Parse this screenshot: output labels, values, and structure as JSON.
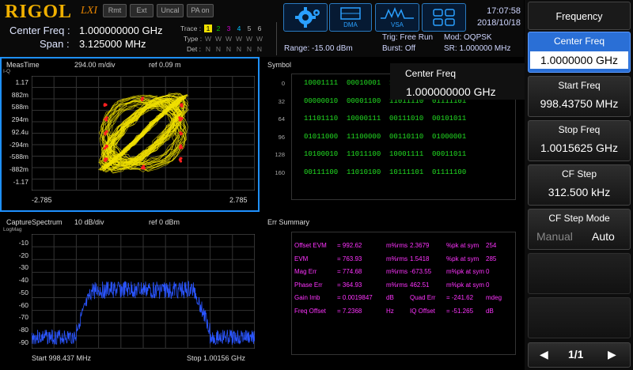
{
  "header": {
    "logo": "RIGOL",
    "lxi": "LXI",
    "status_buttons": [
      "Rmt",
      "Ext",
      "Uncal",
      "PA on"
    ],
    "center_freq_label": "Center Freq :",
    "center_freq_value": "1.000000000 GHz",
    "span_label": "Span :",
    "span_value": "3.125000 MHz",
    "trace_label": "Trace :",
    "trace_numbers": [
      "1",
      "2",
      "3",
      "4",
      "5",
      "6"
    ],
    "type_label": "Type :",
    "type_values": [
      "W",
      "W",
      "W",
      "W",
      "W",
      "W"
    ],
    "det_label": "Det :",
    "det_values": [
      "N",
      "N",
      "N",
      "N",
      "N",
      "N"
    ],
    "range": "Range: -15.00 dBm",
    "trig": "Trig: Free Run",
    "burst": "Burst: Off",
    "mod": "Mod: OQPSK",
    "sr": "SR: 1.000000 MHz",
    "dma": "DMA",
    "vsa": "VSA",
    "time": "17:07:58",
    "date": "2018/10/18",
    "colors": {
      "trace1": "#f0e000",
      "trace2": "#00d000",
      "trace3": "#d000d0",
      "trace4": "#00c0ff",
      "trace5": "#bbbbbb",
      "trace6": "#bbbbbb"
    }
  },
  "meas": {
    "title": "MeasTime",
    "scale": "294.00 m/div",
    "ref": "ref 0.09 m",
    "iq": "I-Q",
    "ylabels": [
      "1.17",
      "882m",
      "588m",
      "294m",
      "92.4u",
      "-294m",
      "-588m",
      "-882m",
      "-1.17"
    ],
    "xleft": "-2.785",
    "xright": "2.785"
  },
  "symbol": {
    "title": "Symbol",
    "rows": [
      {
        "idx": "0",
        "bits": "10001111  00010001  11011110  10111010"
      },
      {
        "idx": "32",
        "bits": "00000010  00001100  11011110  01111101"
      },
      {
        "idx": "64",
        "bits": "11101110  10000111  00111010  00101011"
      },
      {
        "idx": "96",
        "bits": "01011000  11100000  00110110  01000001"
      },
      {
        "idx": "128",
        "bits": "10100010  11011100  10001111  00011011"
      },
      {
        "idx": "160",
        "bits": "00111100  11010100  10111101  01111100"
      }
    ],
    "popup_label": "Center Freq",
    "popup_value": "1.000000000 GHz"
  },
  "spectrum": {
    "title": "CaptureSpectrum",
    "scale": "10 dB/div",
    "ref": "ref 0 dBm",
    "logmag": "LogMag",
    "ylabels": [
      "-10",
      "-20",
      "-30",
      "-40",
      "-50",
      "-60",
      "-70",
      "-80",
      "-90"
    ],
    "start": "Start 998.437 MHz",
    "stop": "Stop 1.00156 GHz"
  },
  "err": {
    "title": "Err Summary",
    "rows": [
      [
        "Offset EVM",
        "= 992.62",
        "m%rms",
        "2.3679",
        "%pk at sym",
        "254"
      ],
      [
        "EVM",
        "= 763.93",
        "m%rms",
        "1.5418",
        "%pk at sym",
        "285"
      ],
      [
        "Mag Err",
        "= 774.68",
        "m%rms",
        "-673.55",
        "m%pk at sym",
        "0"
      ],
      [
        "Phase Err",
        "= 364.93",
        "m%rms",
        "462.51",
        "m%pk at sym",
        "0"
      ],
      [
        "Gain Imb",
        "= 0.0019847",
        "dB",
        "Quad Err",
        "= -241.62",
        "mdeg"
      ],
      [
        "Freq Offset",
        "= 7.2368",
        "Hz",
        "IQ Offset",
        "= -51.265",
        "dB"
      ]
    ]
  },
  "menu": {
    "title": "Frequency",
    "items": [
      {
        "label": "Center Freq",
        "value": "1.0000000 GHz"
      },
      {
        "label": "Start Freq",
        "value": "998.43750 MHz"
      },
      {
        "label": "Stop Freq",
        "value": "1.0015625 GHz"
      },
      {
        "label": "CF Step",
        "value": "312.500 kHz"
      }
    ],
    "step_mode_label": "CF Step Mode",
    "manual": "Manual",
    "auto": "Auto",
    "page": "1/1"
  }
}
